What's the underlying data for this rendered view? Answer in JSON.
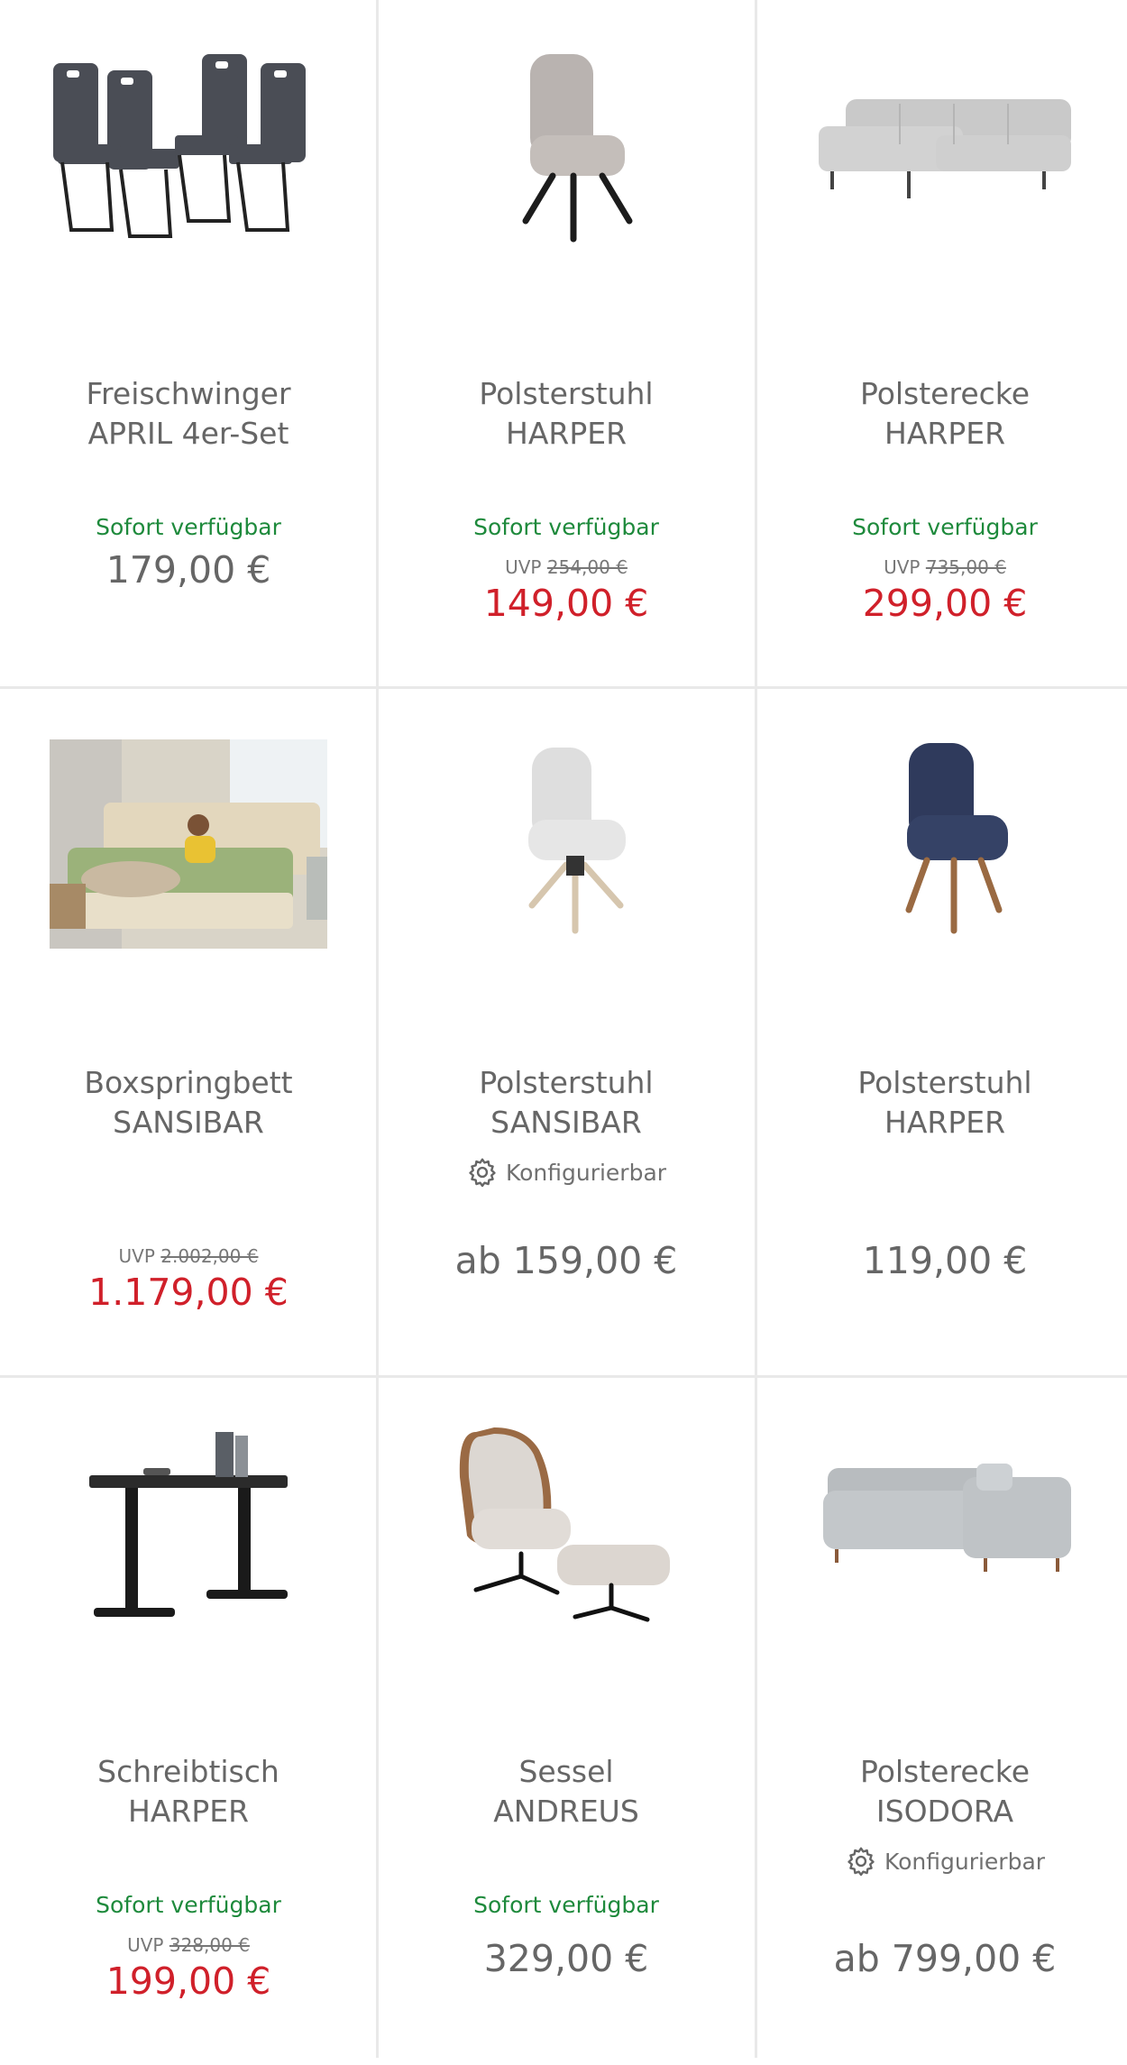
{
  "products": [
    {
      "name_line1": "Freischwinger",
      "name_line2": "APRIL 4er-Set",
      "availability": "Sofort verfügbar",
      "price": "179,00 €"
    },
    {
      "name_line1": "Polsterstuhl",
      "name_line2": "HARPER",
      "availability": "Sofort verfügbar",
      "uvp_label": "UVP",
      "uvp_price": "254,00 €",
      "sale_price": "149,00 €"
    },
    {
      "name_line1": "Polsterecke",
      "name_line2": "HARPER",
      "availability": "Sofort verfügbar",
      "uvp_label": "UVP",
      "uvp_price": "735,00 €",
      "sale_price": "299,00 €"
    },
    {
      "name_line1": "Boxspringbett",
      "name_line2": "SANSIBAR",
      "uvp_label": "UVP",
      "uvp_price": "2.002,00 €",
      "sale_price": "1.179,00 €"
    },
    {
      "name_line1": "Polsterstuhl",
      "name_line2": "SANSIBAR",
      "configurable": "Konfigurierbar",
      "price": "ab 159,00 €"
    },
    {
      "name_line1": "Polsterstuhl",
      "name_line2": "HARPER",
      "price": "119,00 €"
    },
    {
      "name_line1": "Schreibtisch",
      "name_line2": "HARPER",
      "availability": "Sofort verfügbar",
      "uvp_label": "UVP",
      "uvp_price": "328,00 €",
      "sale_price": "199,00 €"
    },
    {
      "name_line1": "Sessel",
      "name_line2": "ANDREUS",
      "availability": "Sofort verfügbar",
      "price": "329,00 €"
    },
    {
      "name_line1": "Polsterecke",
      "name_line2": "ISODORA",
      "configurable": "Konfigurierbar",
      "price": "ab 799,00 €"
    }
  ],
  "icons": {
    "config": "gear-icon"
  },
  "colors": {
    "available": "#1e8a3c",
    "sale": "#d0202a",
    "text": "#666666",
    "divider": "#e9e9e9"
  }
}
